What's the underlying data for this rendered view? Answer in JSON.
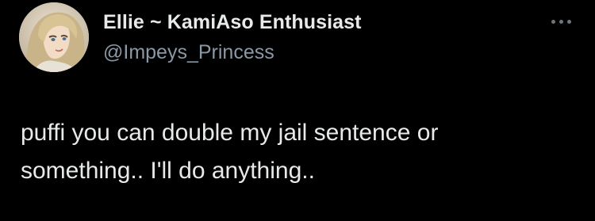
{
  "tweet": {
    "author": {
      "display_name": "Ellie ~ KamiAso Enthusiast",
      "handle": "@Impeys_Princess",
      "avatar_icon": "avatar-anime-character"
    },
    "more_icon": "more-horizontal-icon",
    "text": "puffi you can double my jail sentence or\nsomething.. I'll do anything.."
  },
  "colors": {
    "background": "#000000",
    "primary_text": "#e7e9ea",
    "secondary_text": "#8b98a5",
    "icon": "#6e767d"
  }
}
